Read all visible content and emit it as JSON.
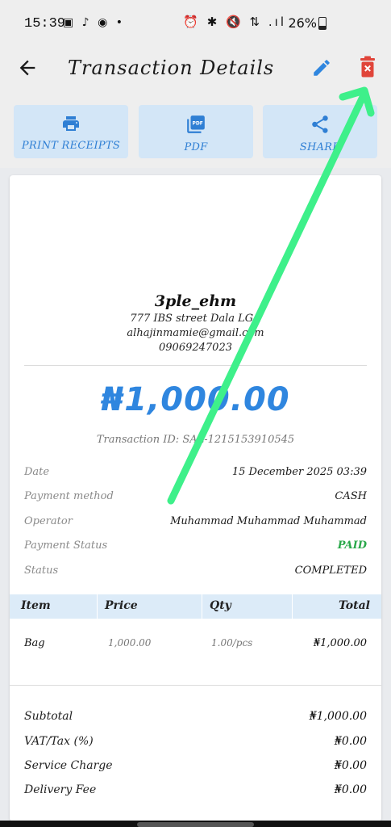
{
  "status_bar": {
    "time": "15:39",
    "left_icons": "▣ ♪ ◉  •",
    "right_icons": "⏰ ✱ 🔇 ⇅ .ıl",
    "battery": "26%"
  },
  "app_bar": {
    "title": "Transaction Details"
  },
  "actions": [
    {
      "label": "PRINT RECEIPTS",
      "icon": "printer-icon"
    },
    {
      "label": "PDF",
      "icon": "pdf-icon"
    },
    {
      "label": "SHARE",
      "icon": "share-icon"
    }
  ],
  "shop": {
    "name": "3ple_ehm",
    "address": "777 IBS street Dala LGA",
    "email": "alhajinmamie@gmail.com",
    "phone": "09069247023"
  },
  "amount": "₦1,000.00",
  "transaction_id": "Transaction ID: SAL-1215153910545",
  "details": {
    "date_label": "Date",
    "date_value": "15 December 2025 03:39",
    "payment_method_label": "Payment method",
    "payment_method_value": "CASH",
    "operator_label": "Operator",
    "operator_value": "Muhammad Muhammad Muhammad",
    "payment_status_label": "Payment Status",
    "payment_status_value": "PAID",
    "status_label": "Status",
    "status_value": "COMPLETED"
  },
  "table": {
    "headers": [
      "Item",
      "Price",
      "Qty",
      "Total"
    ],
    "rows": [
      {
        "item": "Bag",
        "price": "1,000.00",
        "qty": "1.00/pcs",
        "total": "₦1,000.00"
      }
    ]
  },
  "summary": [
    {
      "label": "Subtotal",
      "value": "₦1,000.00"
    },
    {
      "label": "VAT/Tax (%)",
      "value": "₦0.00"
    },
    {
      "label": "Service Charge",
      "value": "₦0.00"
    },
    {
      "label": "Delivery Fee",
      "value": "₦0.00"
    }
  ],
  "colors": {
    "accent": "#2f86df",
    "delete": "#e0453a",
    "paid": "#29a84a",
    "annotation_arrow": "#3ef08a"
  }
}
